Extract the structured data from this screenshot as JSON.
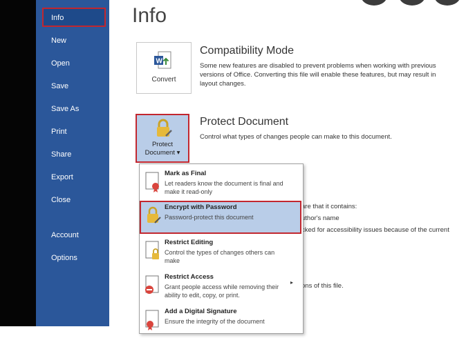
{
  "nav": {
    "items": [
      {
        "label": "Info"
      },
      {
        "label": "New"
      },
      {
        "label": "Open"
      },
      {
        "label": "Save"
      },
      {
        "label": "Save As"
      },
      {
        "label": "Print"
      },
      {
        "label": "Share"
      },
      {
        "label": "Export"
      },
      {
        "label": "Close"
      },
      {
        "label": "Account"
      },
      {
        "label": "Options"
      }
    ]
  },
  "page_title": "Info",
  "compatibility": {
    "title": "Compatibility Mode",
    "desc_line1": "Some new features are disabled to prevent problems when working with previous",
    "desc_line2": "versions of Office. Converting this file will enable these features, but may result in",
    "desc_line3": "layout changes.",
    "button_label": "Convert"
  },
  "protect": {
    "title": "Protect Document",
    "desc": "Control what types of changes people can make to this document.",
    "button_line1": "Protect",
    "button_line2": "Document ▾"
  },
  "menu": [
    {
      "title": "Mark as Final",
      "desc": "Let readers know the document is final and make it read-only"
    },
    {
      "title": "Encrypt with Password",
      "desc": "Password-protect this document"
    },
    {
      "title": "Restrict Editing",
      "desc": "Control the types of changes others can make"
    },
    {
      "title": "Restrict Access",
      "desc": "Grant people access while removing their ability to edit, copy, or print."
    },
    {
      "title": "Add a Digital Signature",
      "desc": "Ensure the integrity of the document"
    }
  ],
  "partial_text": {
    "line1": "are that it contains:",
    "line2": "uthor's name",
    "line3": "cked for accessibility issues because of the current",
    "line4": "ons of this file."
  }
}
